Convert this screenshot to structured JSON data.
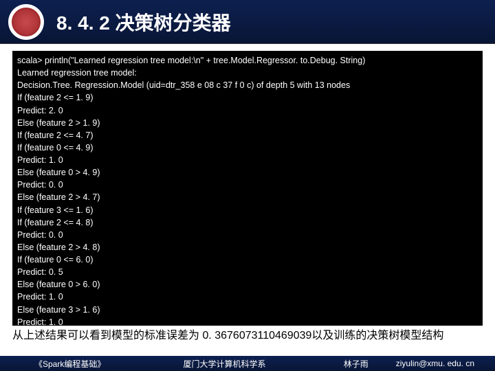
{
  "header": {
    "title": "8. 4. 2 决策树分类器"
  },
  "code": {
    "lines": [
      "scala> println(\"Learned regression tree model:\\n\" + tree.Model.Regressor. to.Debug. String)",
      "Learned regression tree model:",
      "Decision.Tree. Regression.Model (uid=dtr_358 e 08 c 37 f 0 c) of depth 5 with 13 nodes",
      "If (feature 2 <= 1. 9)",
      "Predict: 2. 0",
      "Else (feature 2 > 1. 9)",
      "If (feature 2 <= 4. 7)",
      "If (feature 0 <= 4. 9)",
      "Predict: 1. 0",
      "Else (feature 0 > 4. 9)",
      "Predict: 0. 0",
      "Else (feature 2 > 4. 7)",
      "If (feature 3 <= 1. 6)",
      "If (feature 2 <= 4. 8)",
      "Predict: 0. 0",
      "Else (feature 2 > 4. 8)",
      "If (feature 0 <= 6. 0)",
      "Predict: 0. 5",
      "Else (feature 0 > 6. 0)",
      "Predict: 1. 0",
      "Else (feature 3 > 1. 6)",
      "Predict: 1. 0"
    ]
  },
  "body": {
    "text": "从上述结果可以看到模型的标准误差为 0. 3676073110469039以及训练的决策树模型结构"
  },
  "footer": {
    "book": "《Spark编程基础》",
    "dept": "厦门大学计算机科学系",
    "name": "林子雨",
    "email": "ziyulin@xmu. edu. cn"
  }
}
